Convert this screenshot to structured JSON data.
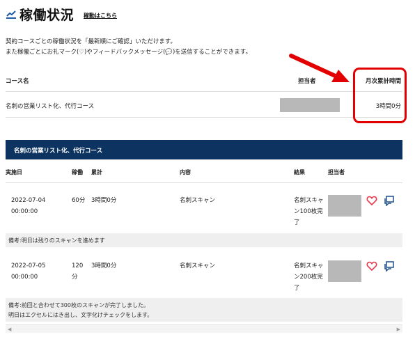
{
  "header": {
    "title": "稼働状況",
    "link_label": "稼動はこちら",
    "icon": "chart-line-icon"
  },
  "intro": {
    "line1": "契約コースごとの稼働状況を「最新順にご確認」いただけます。",
    "line2": "また稼働ごとにお礼マーク(♡)やフィードバックメッセージ(💬)を送信することができます。"
  },
  "summary": {
    "headers": {
      "course": "コース名",
      "person": "担当者",
      "monthly": "月次累計時間"
    },
    "row": {
      "course": "名刺の営業リスト化、代行コース",
      "monthly": "3時間0分"
    }
  },
  "detail": {
    "section_title": "名刺の営業リスト化、代行コース",
    "headers": {
      "date": "実施日",
      "duration": "稼働",
      "cumulative": "累計",
      "content": "内容",
      "result": "結果",
      "person": "担当者"
    },
    "entries": [
      {
        "date": "2022-07-04 00:00:00",
        "duration": "60分",
        "cumulative": "3時間0分",
        "content": "名刺スキャン",
        "result": "名刺スキャン100枚完了",
        "note": "備考:明日は残りのスキャンを進めます"
      },
      {
        "date": "2022-07-05 00:00:00",
        "duration": "120分",
        "cumulative": "3時間0分",
        "content": "名刺スキャン",
        "result": "名刺スキャン200枚完了",
        "note_line1": "備考:前回と合わせて300枚のスキャンが完了しました。",
        "note_line2": "明日はエクセルにはき出し、文字化けチェックをします。"
      }
    ]
  },
  "icons": {
    "heart": "heart-icon",
    "message": "message-icon"
  },
  "colors": {
    "accent_blue": "#0d3460",
    "annotation_red": "#e30000",
    "heart_red": "#e8364a",
    "icon_blue": "#1e4f8c"
  }
}
